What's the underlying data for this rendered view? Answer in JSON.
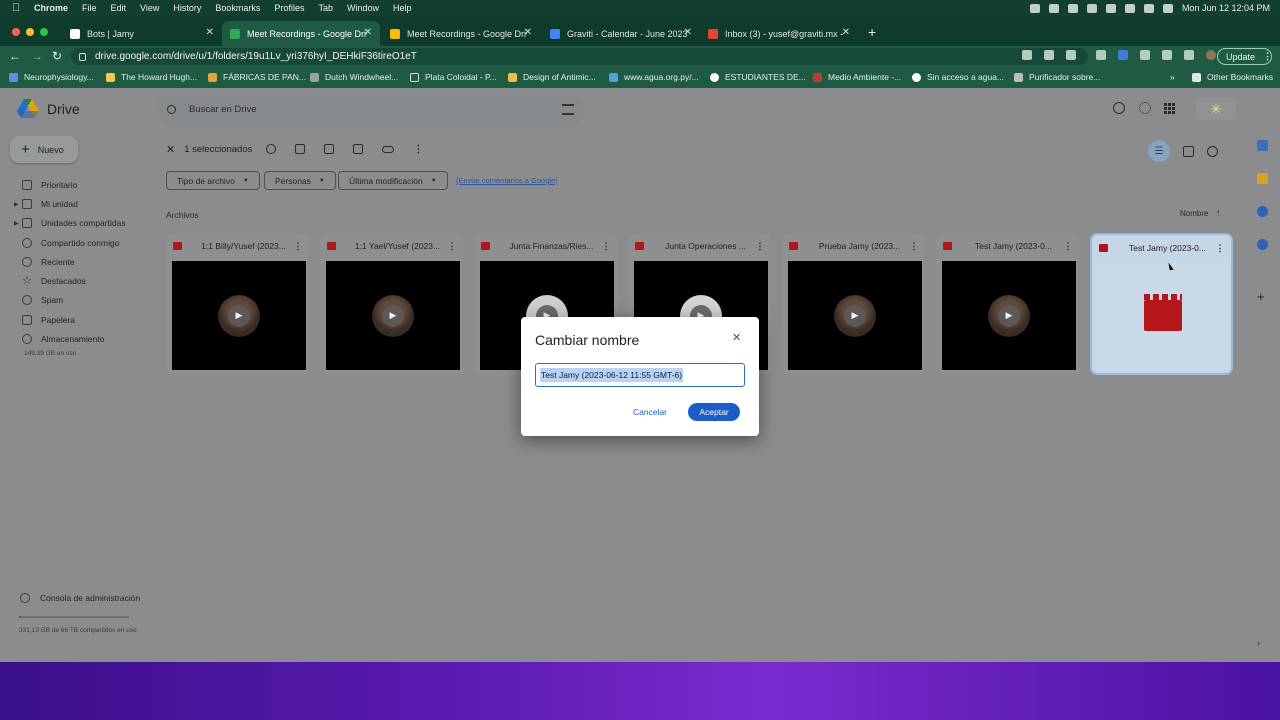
{
  "menubar": {
    "app": "Chrome",
    "items": [
      "File",
      "Edit",
      "View",
      "History",
      "Bookmarks",
      "Profiles",
      "Tab",
      "Window",
      "Help"
    ],
    "clock": "Mon Jun 12  12:04 PM"
  },
  "tabs": [
    {
      "title": "Bots | Jamy",
      "color": "#ffffff"
    },
    {
      "title": "Meet Recordings - Google Drive",
      "color": "#34a853"
    },
    {
      "title": "Meet Recordings - Google Drive",
      "color": "#fbbc04"
    },
    {
      "title": "Graviti - Calendar - June 2023",
      "color": "#4285f4"
    },
    {
      "title": "Inbox (3) - yusef@graviti.mx -",
      "color": "#ea4335"
    }
  ],
  "browser": {
    "url": "drive.google.com/drive/u/1/folders/19u1Lv_yri376hyI_DEHkiF36tireO1eT",
    "update_label": "Update"
  },
  "bookmarks": [
    {
      "label": "Neurophysiology...",
      "color": "#5b8def"
    },
    {
      "label": "The Howard Hugh...",
      "color": "#f2c94c"
    },
    {
      "label": "FÁBRICAS DE PAN...",
      "color": "#e0a43a"
    },
    {
      "label": "Dutch Windwheel...",
      "color": "#9aa0a6"
    },
    {
      "label": "Plata Coloidal - P...",
      "color": "#1f5a43"
    },
    {
      "label": "Design of Antimic...",
      "color": "#e8c04a"
    },
    {
      "label": "www.agua.org.py/...",
      "color": "#4aa3df"
    },
    {
      "label": "ESTUDIANTES DE...",
      "color": "#ffffff"
    },
    {
      "label": "Medio Ambiente -...",
      "color": "#c0392b"
    },
    {
      "label": "Sin acceso a agua...",
      "color": "#ffffff"
    },
    {
      "label": "Purificador sobre...",
      "color": "#bbbbbb"
    },
    {
      "label": "Other Bookmarks",
      "color": "#dfe9e3"
    }
  ],
  "drive": {
    "logo_text": "Drive",
    "new_label": "Nuevo",
    "nav": [
      "Prioritario",
      "Mi unidad",
      "Unidades compartidas",
      "Compartido conmigo",
      "Reciente",
      "Destacados",
      "Spam",
      "Papelera",
      "Almacenamiento"
    ],
    "storage_used": "149,39 GB en uso",
    "admin_console": "Consola de administración",
    "shared_storage": "331,13 GB de 66 TB compartidos en uso",
    "shared_storage_fraction": 0.005,
    "search_placeholder": "Buscar en Drive",
    "selection_count": "1 seleccionados",
    "filters": [
      "Tipo de archivo",
      "Personas",
      "Última modificación"
    ],
    "feedback_link": "(Enviar comentarios a Google)",
    "section_title": "Archivos",
    "sort_label": "Nombre",
    "files": [
      {
        "name": "1:1 Billy/Yusef (2023..."
      },
      {
        "name": "1:1 Yael/Yusef (2023..."
      },
      {
        "name": "Junta Finanzas/Ries..."
      },
      {
        "name": "Junta Operaciones ..."
      },
      {
        "name": "Prueba Jamy (2023..."
      },
      {
        "name": "Test Jamy (2023-0..."
      },
      {
        "name": "Test Jamy (2023-0..."
      }
    ]
  },
  "dialog": {
    "title": "Cambiar nombre",
    "value": "Test Jamy (2023-06-12 11:55 GMT-6)",
    "cancel": "Cancelar",
    "ok": "Aceptar"
  }
}
